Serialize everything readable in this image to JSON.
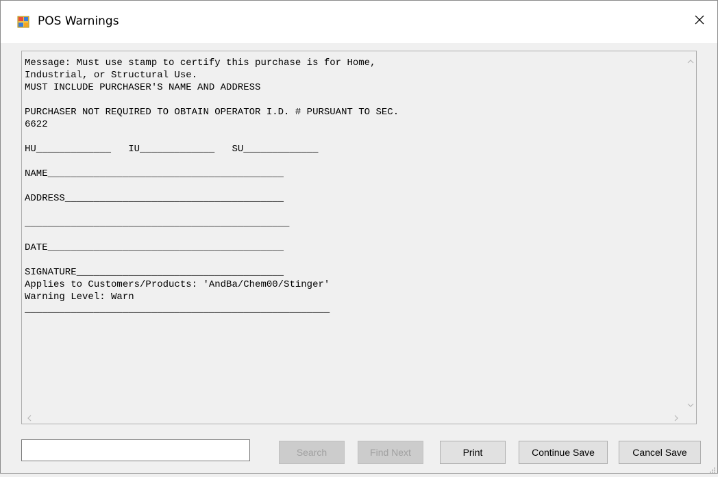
{
  "window": {
    "title": "POS Warnings"
  },
  "message_lines": [
    "Message: Must use stamp to certify this purchase is for Home,",
    "Industrial, or Structural Use.",
    "MUST INCLUDE PURCHASER'S NAME AND ADDRESS",
    "",
    "PURCHASER NOT REQUIRED TO OBTAIN OPERATOR I.D. # PURSUANT TO SEC.",
    "6622",
    "",
    "HU_____________   IU_____________   SU_____________",
    "",
    "NAME_________________________________________",
    "",
    "ADDRESS______________________________________",
    "",
    "______________________________________________",
    "",
    "DATE_________________________________________",
    "",
    "SIGNATURE____________________________________",
    "Applies to Customers/Products: 'AndBa/Chem00/Stinger'",
    "Warning Level: Warn",
    "_____________________________________________________"
  ],
  "search": {
    "value": "",
    "placeholder": ""
  },
  "buttons": {
    "search": "Search",
    "find_next": "Find Next",
    "print": "Print",
    "continue_save": "Continue Save",
    "cancel_save": "Cancel Save"
  },
  "icons": {
    "app": "form-window-icon",
    "close": "close-icon",
    "scroll_up": "chevron-up-icon",
    "scroll_down": "chevron-down-icon",
    "scroll_left": "chevron-left-icon",
    "scroll_right": "chevron-right-icon"
  }
}
